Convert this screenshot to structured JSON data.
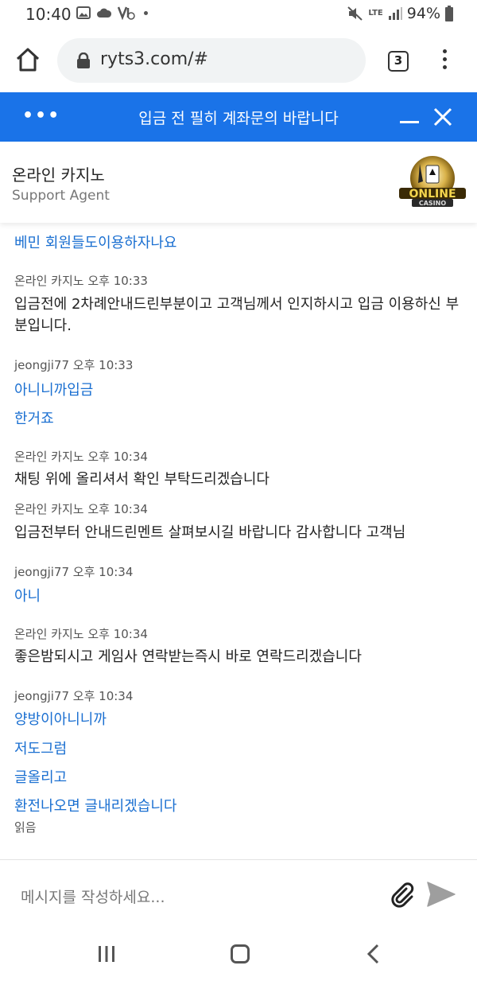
{
  "status_bar": {
    "time": "10:40",
    "network": "LTE",
    "battery": "94%"
  },
  "browser": {
    "url": "ryts3.com/#",
    "tab_count": "3"
  },
  "chat_header": {
    "title": "입금 전 필히 계좌문의 바랍니다"
  },
  "agent": {
    "name": "온라인 카지노",
    "role": "Support Agent",
    "logo_text": "ONLINE CASINO"
  },
  "messages": [
    {
      "type": "user-text",
      "text": "베민 회원들도이용하자나요"
    },
    {
      "type": "meta",
      "text": "온라인 카지노 오후 10:33"
    },
    {
      "type": "agent-text",
      "text": "입금전에 2차례안내드린부분이고 고객님께서 인지하시고 입금 이용하신 부분입니다."
    },
    {
      "type": "meta",
      "text": "jeongji77 오후 10:33"
    },
    {
      "type": "user-text",
      "text": "아니니까입금"
    },
    {
      "type": "user-text",
      "text": "한거죠"
    },
    {
      "type": "meta",
      "text": "온라인 카지노 오후 10:34"
    },
    {
      "type": "agent-text",
      "text": "채팅 위에 올리셔서 확인 부탁드리겠습니다"
    },
    {
      "type": "meta",
      "text": "온라인 카지노 오후 10:34"
    },
    {
      "type": "agent-text",
      "text": "입금전부터 안내드린멘트 살펴보시길 바랍니다 감사합니다 고객님"
    },
    {
      "type": "meta",
      "text": "jeongji77 오후 10:34"
    },
    {
      "type": "user-text",
      "text": "아니"
    },
    {
      "type": "meta",
      "text": "온라인 카지노 오후 10:34"
    },
    {
      "type": "agent-text",
      "text": "좋은밤되시고 게임사 연락받는즉시 바로 연락드리겠습니다"
    },
    {
      "type": "meta",
      "text": "jeongji77 오후 10:34"
    },
    {
      "type": "user-text",
      "text": "양방이아니니까"
    },
    {
      "type": "user-text",
      "text": "저도그럼"
    },
    {
      "type": "user-text",
      "text": "글올리고"
    },
    {
      "type": "user-text",
      "text": "환전나오면 글내리겠습니다"
    },
    {
      "type": "meta",
      "text": "읽음"
    }
  ],
  "composer": {
    "placeholder": "메시지를 작성하세요..."
  },
  "colors": {
    "accent": "#1a73e8",
    "user_text": "#1a6fd1"
  }
}
